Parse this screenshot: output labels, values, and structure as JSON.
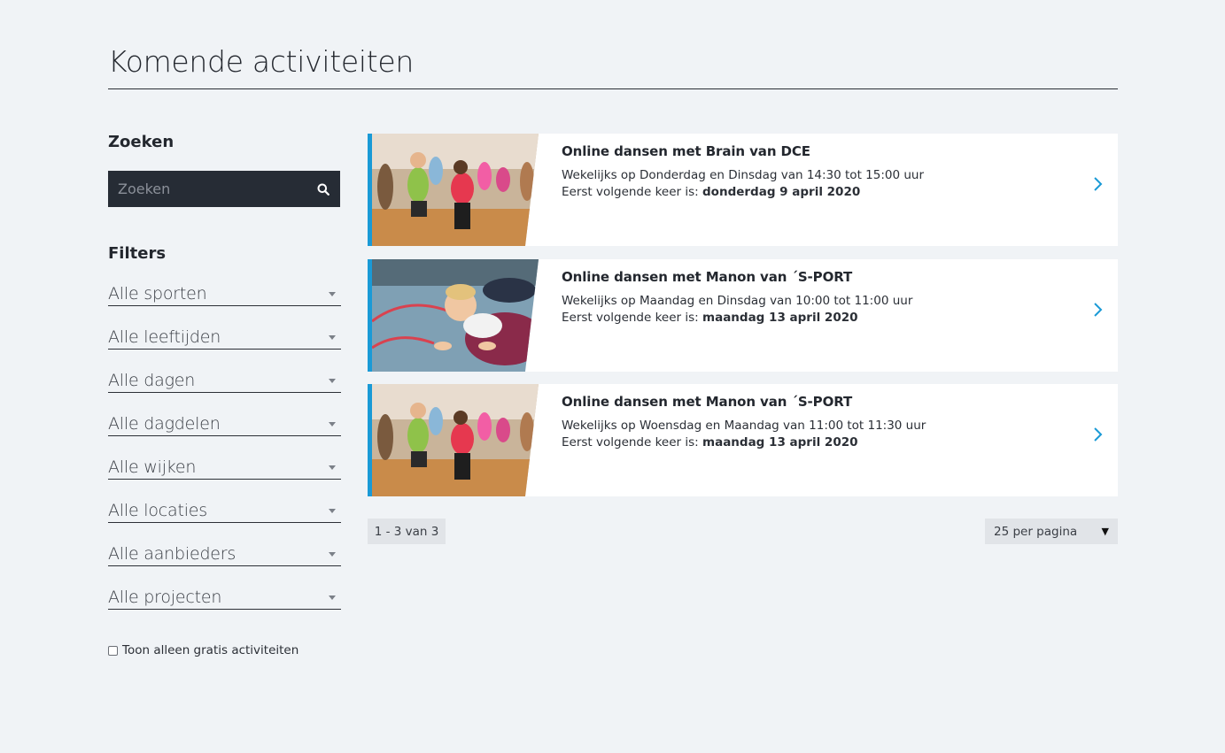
{
  "page": {
    "title": "Komende activiteiten"
  },
  "sidebar": {
    "search_heading": "Zoeken",
    "search_placeholder": "Zoeken",
    "filters_heading": "Filters",
    "filters": [
      {
        "label": "Alle sporten"
      },
      {
        "label": "Alle leeftijden"
      },
      {
        "label": "Alle dagen"
      },
      {
        "label": "Alle dagdelen"
      },
      {
        "label": "Alle wijken"
      },
      {
        "label": "Alle locaties"
      },
      {
        "label": "Alle aanbieders"
      },
      {
        "label": "Alle projecten"
      }
    ],
    "free_only_label": "Toon alleen gratis activiteiten",
    "free_only_checked": false
  },
  "activities": [
    {
      "title": "Online dansen met Brain van DCE",
      "schedule": "Wekelijks op Donderdag en Dinsdag van 14:30 tot 15:00 uur",
      "next_prefix": "Eerst volgende keer is: ",
      "next_date": "donderdag 9 april 2020",
      "image": "dance-class-photo"
    },
    {
      "title": "Online dansen met Manon van ´S-PORT",
      "schedule": "Wekelijks op Maandag en Dinsdag van 10:00 tot 11:00 uur",
      "next_prefix": "Eerst volgende keer is: ",
      "next_date": "maandag 13 april 2020",
      "image": "crawling-child-photo"
    },
    {
      "title": "Online dansen met Manon van ´S-PORT",
      "schedule": "Wekelijks op Woensdag en Maandag van 11:00 tot 11:30 uur",
      "next_prefix": "Eerst volgende keer is: ",
      "next_date": "maandag 13 april 2020",
      "image": "dance-class-photo"
    }
  ],
  "pagination": {
    "range_label": "1 - 3 van 3",
    "per_page_label": "25 per pagina"
  },
  "colors": {
    "accent": "#1a9ad6",
    "search_bg": "#262c35",
    "page_bg": "#f0f3f6"
  },
  "icons": {
    "search": "search-icon",
    "card_arrow": "chevron-right-icon",
    "select_caret": "caret-down-icon"
  }
}
